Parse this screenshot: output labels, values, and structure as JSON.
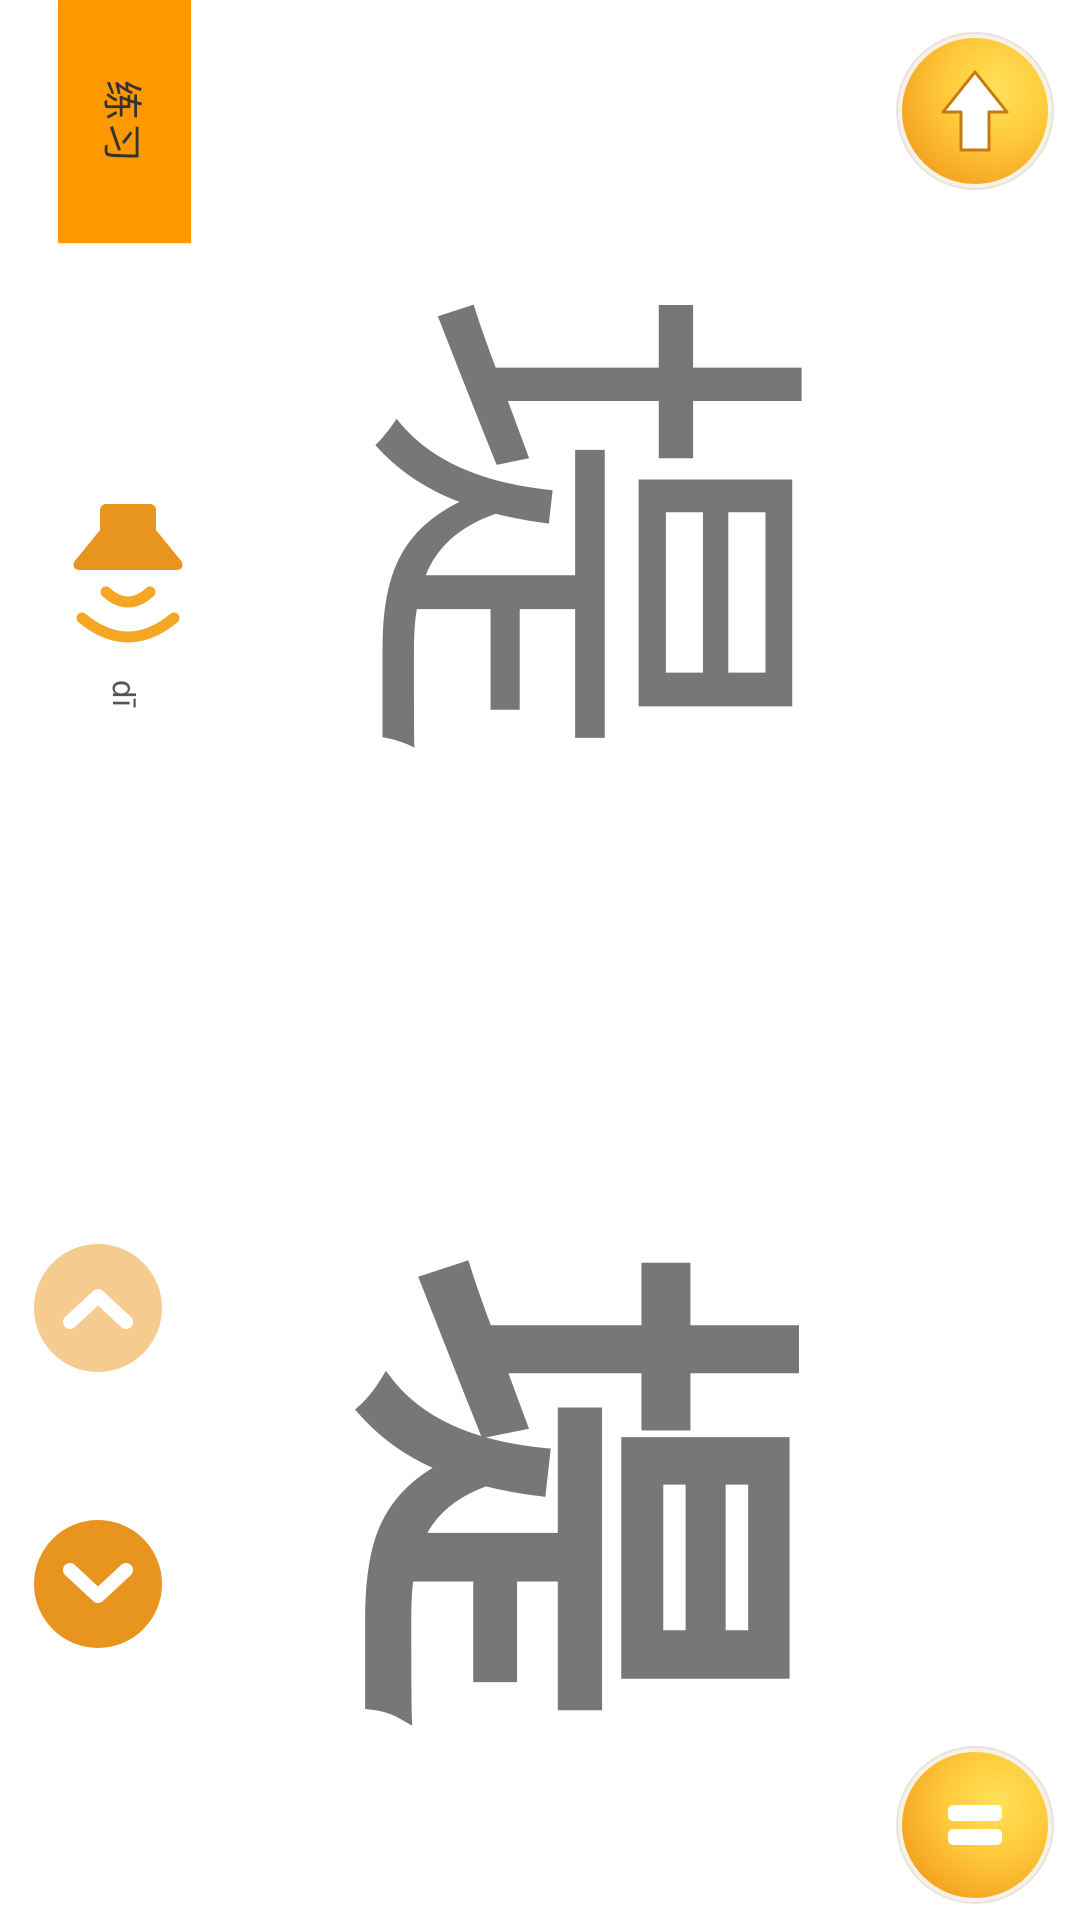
{
  "practice_tab": {
    "label": "练习"
  },
  "lesson": {
    "pinyin": "dī",
    "character_calligraphy": "堤",
    "character_block": "堤"
  },
  "icons": {
    "speaker": "speaker-icon",
    "nav_up": "chevron-up-icon",
    "nav_down": "chevron-down-icon",
    "upload": "arrow-up-icon",
    "menu": "menu-icon"
  },
  "colors": {
    "accent_orange": "#FF9900",
    "icon_orange": "#E8951F",
    "nav_up_disabled": "#F5CB8F",
    "coin_gold": "#FFC93A",
    "character_gray": "#777777"
  }
}
